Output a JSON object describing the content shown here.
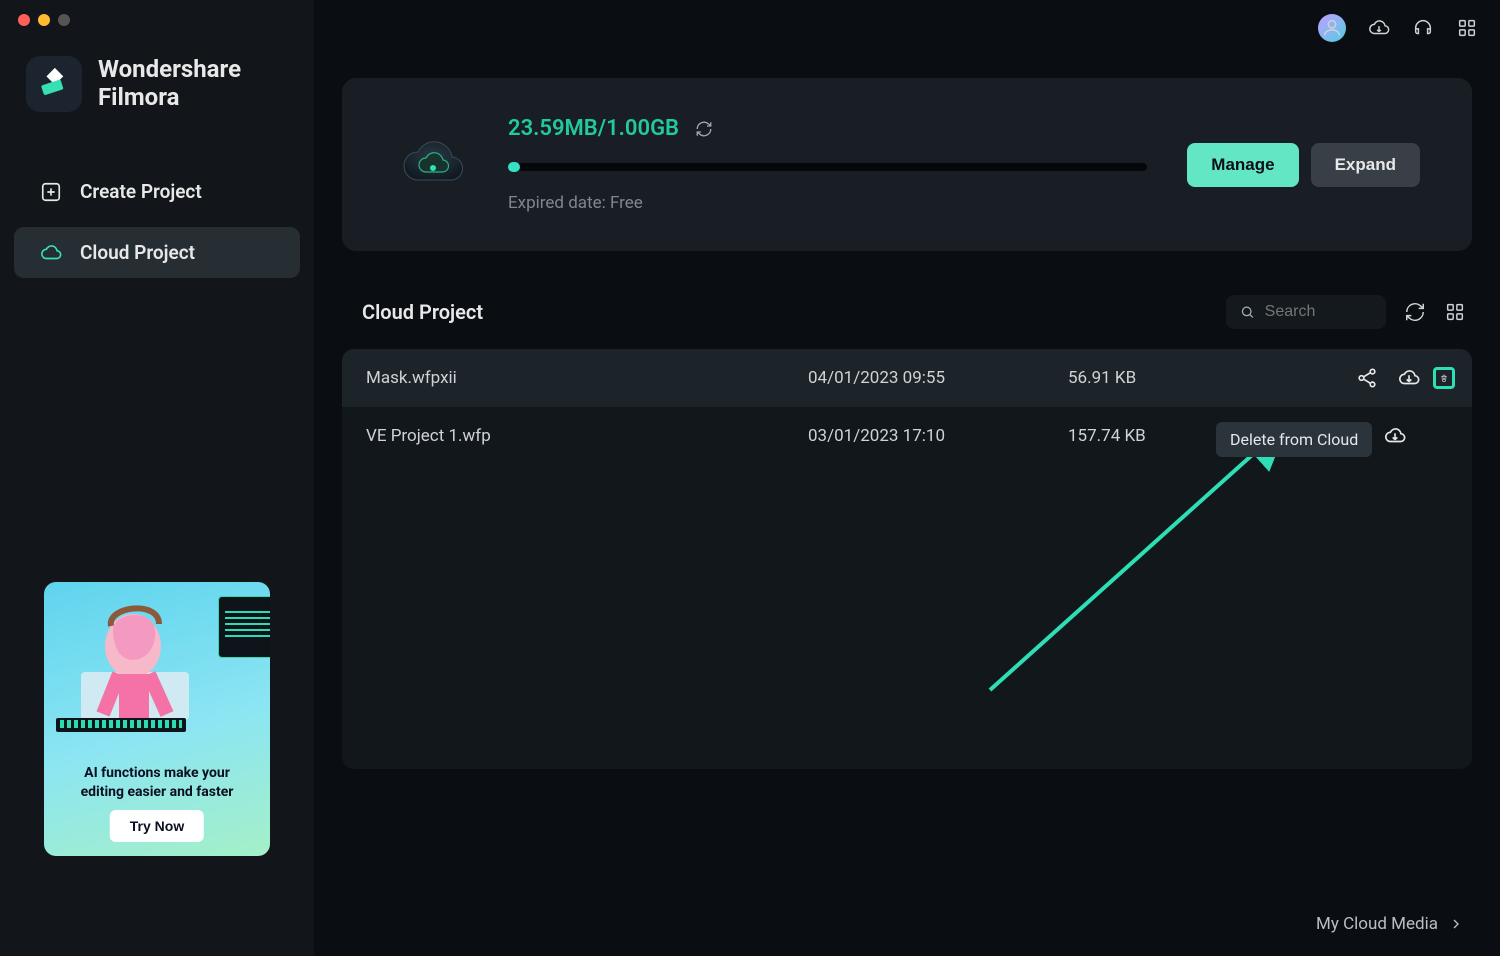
{
  "brand": {
    "line1": "Wondershare",
    "line2": "Filmora"
  },
  "sidebar": {
    "items": [
      {
        "icon": "plus-box",
        "label": "Create Project"
      },
      {
        "icon": "cloud",
        "label": "Cloud Project"
      }
    ]
  },
  "promo": {
    "caption_line1": "AI functions make your",
    "caption_line2": "editing easier and faster",
    "button": "Try Now"
  },
  "storage": {
    "usage_label": "23.59MB/1.00GB",
    "expired_prefix": "Expired date: ",
    "expired_value": "Free",
    "progress_percent": 2.3,
    "manage_label": "Manage",
    "expand_label": "Expand"
  },
  "list": {
    "title": "Cloud Project",
    "search_placeholder": "Search",
    "rows": [
      {
        "name": "Mask.wfpxii",
        "date": "04/01/2023 09:55",
        "size": "56.91 KB"
      },
      {
        "name": "VE Project 1.wfp",
        "date": "03/01/2023 17:10",
        "size": "157.74 KB"
      }
    ]
  },
  "tooltip": {
    "delete_from_cloud": "Delete from Cloud"
  },
  "footer": {
    "my_cloud_media": "My Cloud Media"
  }
}
